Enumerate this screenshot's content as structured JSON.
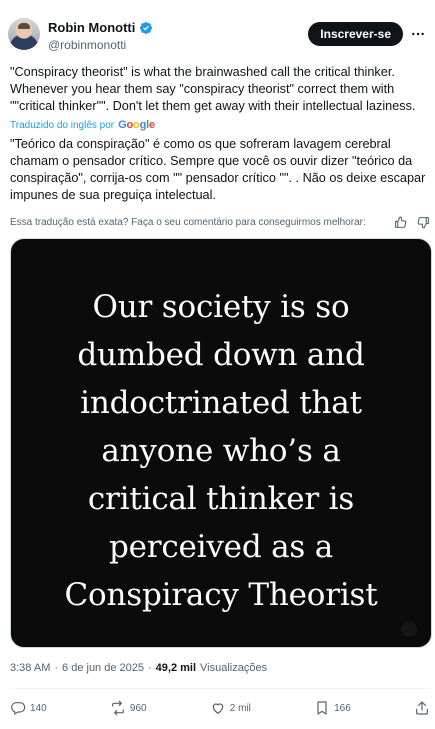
{
  "author": {
    "display_name": "Robin Monotti",
    "handle": "@robinmonotti",
    "verified_badge_color": "#1d9bf0"
  },
  "header": {
    "subscribe_label": "Inscrever-se"
  },
  "tweet": {
    "text": "\"Conspiracy theorist\" is what the brainwashed call the critical thinker. Whenever you hear them say \"conspiracy theorist\" correct them with \"\"critical thinker\"\". Don't let them get away with their intellectual laziness.",
    "translated_by_label": "Traduzido do inglês por",
    "translated_by_provider": "Google",
    "translation": "\"Teórico da conspiração\" é como os que sofreram lavagem cerebral chamam o pensador crítico. Sempre que você os ouvir dizer \"teórico da conspiração\", corrija-os com \"\" pensador crítico \"\". . Não os deixe escapar impunes de sua preguiça intelectual.",
    "feedback_question": "Essa tradução está exata? Faça o seu comentário para conseguirmos melhorar:"
  },
  "media": {
    "quote_lines": [
      "Our society is so",
      "dumbed down and",
      "indoctrinated that",
      "anyone who’s a",
      "critical thinker is",
      "perceived as a",
      "Conspiracy Theorist"
    ]
  },
  "meta": {
    "time": "3:38 AM",
    "separator": "·",
    "date": "6 de jun de 2025",
    "views_count": "49,2 mil",
    "views_label": "Visualizações"
  },
  "actions": {
    "replies": "140",
    "reposts": "960",
    "likes": "2 mil",
    "bookmarks": "166"
  },
  "colors": {
    "text_primary": "#0f1419",
    "text_secondary": "#536471",
    "accent": "#1d9bf0",
    "media_bg": "#0b0b0b"
  },
  "icons": [
    "verified-badge-icon",
    "more-options-icon",
    "thumbs-up-icon",
    "thumbs-down-icon",
    "reply-icon",
    "repost-icon",
    "like-icon",
    "bookmark-icon",
    "share-icon"
  ]
}
